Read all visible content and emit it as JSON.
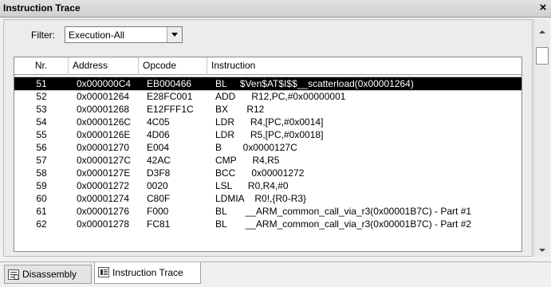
{
  "window": {
    "title": "Instruction Trace",
    "close_label": "×"
  },
  "filter": {
    "label": "Filter:",
    "value": "Execution-All"
  },
  "columns": [
    "Nr.",
    "Address",
    "Opcode",
    "Instruction"
  ],
  "rows": [
    {
      "nr": "51",
      "address": "0x000000C4",
      "opcode": "EB000466",
      "instruction": "BL     $Ven$AT$I$$__scatterload(0x00001264)",
      "selected": true
    },
    {
      "nr": "52",
      "address": "0x00001264",
      "opcode": "E28FC001",
      "instruction": "ADD      R12,PC,#0x00000001"
    },
    {
      "nr": "53",
      "address": "0x00001268",
      "opcode": "E12FFF1C",
      "instruction": "BX       R12"
    },
    {
      "nr": "54",
      "address": "0x0000126C",
      "opcode": "4C05",
      "instruction": "LDR      R4,[PC,#0x0014]"
    },
    {
      "nr": "55",
      "address": "0x0000126E",
      "opcode": "4D06",
      "instruction": "LDR      R5,[PC,#0x0018]"
    },
    {
      "nr": "56",
      "address": "0x00001270",
      "opcode": "E004",
      "instruction": "B        0x0000127C"
    },
    {
      "nr": "57",
      "address": "0x0000127C",
      "opcode": "42AC",
      "instruction": "CMP      R4,R5"
    },
    {
      "nr": "58",
      "address": "0x0000127E",
      "opcode": "D3F8",
      "instruction": "BCC      0x00001272"
    },
    {
      "nr": "59",
      "address": "0x00001272",
      "opcode": "0020",
      "instruction": "LSL      R0,R4,#0"
    },
    {
      "nr": "60",
      "address": "0x00001274",
      "opcode": "C80F",
      "instruction": "LDMIA    R0!,{R0-R3}"
    },
    {
      "nr": "61",
      "address": "0x00001276",
      "opcode": "F000",
      "instruction": "BL       __ARM_common_call_via_r3(0x00001B7C) - Part #1"
    },
    {
      "nr": "62",
      "address": "0x00001278",
      "opcode": "FC81",
      "instruction": "BL       __ARM_common_call_via_r3(0x00001B7C) - Part #2"
    }
  ],
  "tabs": [
    {
      "label": "Disassembly",
      "icon": "disassembly-icon",
      "active": false
    },
    {
      "label": "Instruction Trace",
      "icon": "trace-icon",
      "active": true
    }
  ]
}
